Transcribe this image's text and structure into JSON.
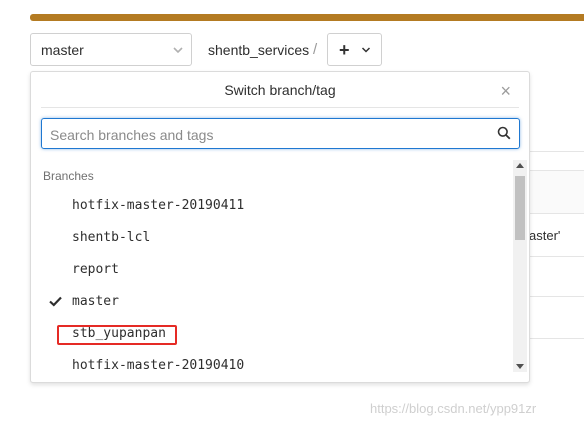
{
  "toolbar": {
    "branch_select_value": "master",
    "breadcrumb_project": "shentb_services",
    "breadcrumb_separator": "/",
    "add_button_label": "+"
  },
  "background": {
    "partial_text": "aster'"
  },
  "dropdown": {
    "title": "Switch branch/tag",
    "close_label": "×",
    "search_placeholder": "Search branches and tags",
    "search_value": "",
    "section_header": "Branches",
    "branches": [
      {
        "name": "hotfix-master-20190411",
        "selected": false
      },
      {
        "name": "shentb-lcl",
        "selected": false
      },
      {
        "name": "report",
        "selected": false
      },
      {
        "name": "master",
        "selected": true
      },
      {
        "name": "stb_yupanpan",
        "selected": false
      },
      {
        "name": "hotfix-master-20190410",
        "selected": false
      }
    ],
    "highlighted_branch": "stb_yupanpan"
  },
  "watermark": "https://blog.csdn.net/ypp91zr",
  "colors": {
    "accent_bar": "#b47b22",
    "search_focus_border": "#1f78d1",
    "highlight_box": "#e52a25"
  },
  "icons": {
    "branch_select": "chevron-down-icon",
    "add_button": [
      "plus-icon",
      "chevron-down-icon"
    ],
    "search": "search-icon",
    "selected_branch": "check-icon"
  }
}
